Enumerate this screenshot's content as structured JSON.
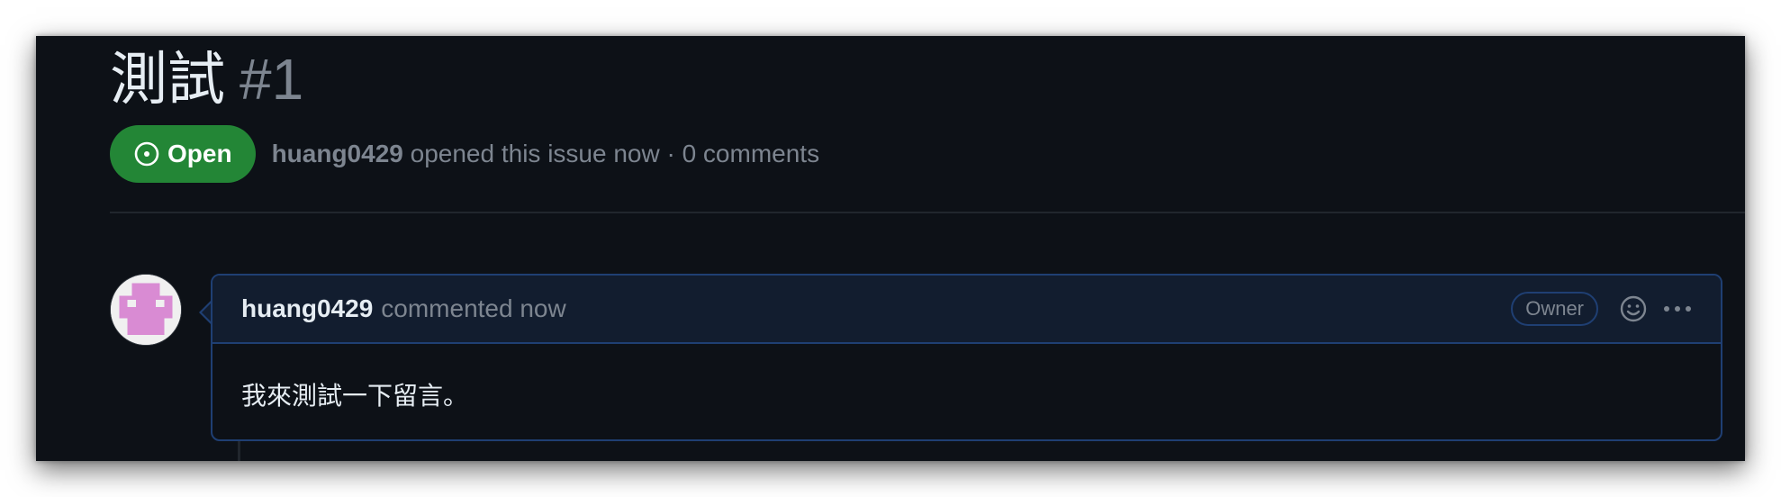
{
  "issue": {
    "title": "測試",
    "number": "#1",
    "state_label": "Open",
    "author": "huang0429",
    "meta_text": "opened this issue now · 0 comments"
  },
  "comment": {
    "author": "huang0429",
    "action_text": "commented now",
    "role_badge": "Owner",
    "body": "我來測試一下留言。"
  },
  "icons": {
    "state": "issue-opened-icon",
    "reaction": "smiley-icon",
    "more": "kebab-horizontal-icon"
  },
  "colors": {
    "open_green": "#238636",
    "background": "#0d1117",
    "accent_border": "#1f3f73",
    "muted_text": "#7d8590",
    "avatar_pink": "#d98bd3"
  }
}
